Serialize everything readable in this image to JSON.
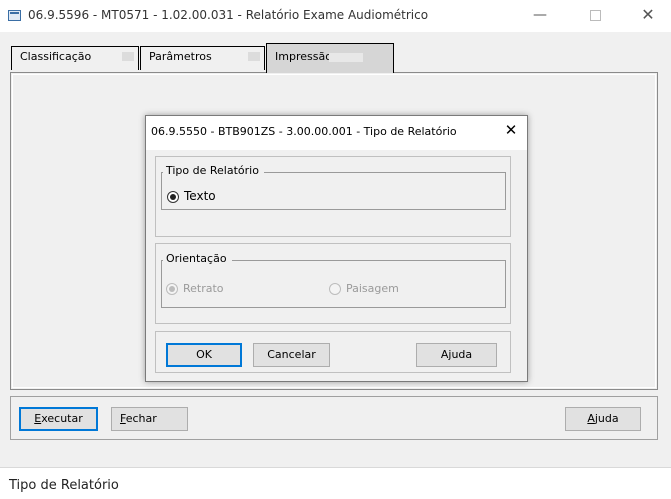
{
  "window": {
    "title": "06.9.5596 - MT0571 - 1.02.00.031 - Relatório Exame Audiométrico",
    "minimize": "—",
    "close": "✕"
  },
  "tabs": [
    {
      "label": "Classificação",
      "active": false
    },
    {
      "label": "Parâmetros",
      "active": false
    },
    {
      "label": "Impressão",
      "active": true
    }
  ],
  "buttons": {
    "executar": {
      "hotkey": "E",
      "rest": "xecutar"
    },
    "fechar": {
      "hotkey": "F",
      "rest": "echar"
    },
    "ajuda": {
      "hotkey": "A",
      "rest": "juda"
    }
  },
  "status": {
    "text": "Tipo de Relatório"
  },
  "dialog": {
    "title": "06.9.5550 - BTB901ZS - 3.00.00.001 - Tipo de Relatório",
    "close": "✕",
    "tipo_group": {
      "legend": "Tipo de Relatório",
      "option": "Texto",
      "selected": true
    },
    "orientacao_group": {
      "legend": "Orientação",
      "options": [
        {
          "label": "Retrato",
          "selected": true,
          "disabled": true
        },
        {
          "label": "Paisagem",
          "selected": false,
          "disabled": true
        }
      ]
    },
    "buttons": {
      "ok": "OK",
      "cancelar": "Cancelar",
      "ajuda": "Ajuda"
    }
  },
  "colors": {
    "focus_border": "#0078d7",
    "window_bg": "#f0f0f0"
  }
}
